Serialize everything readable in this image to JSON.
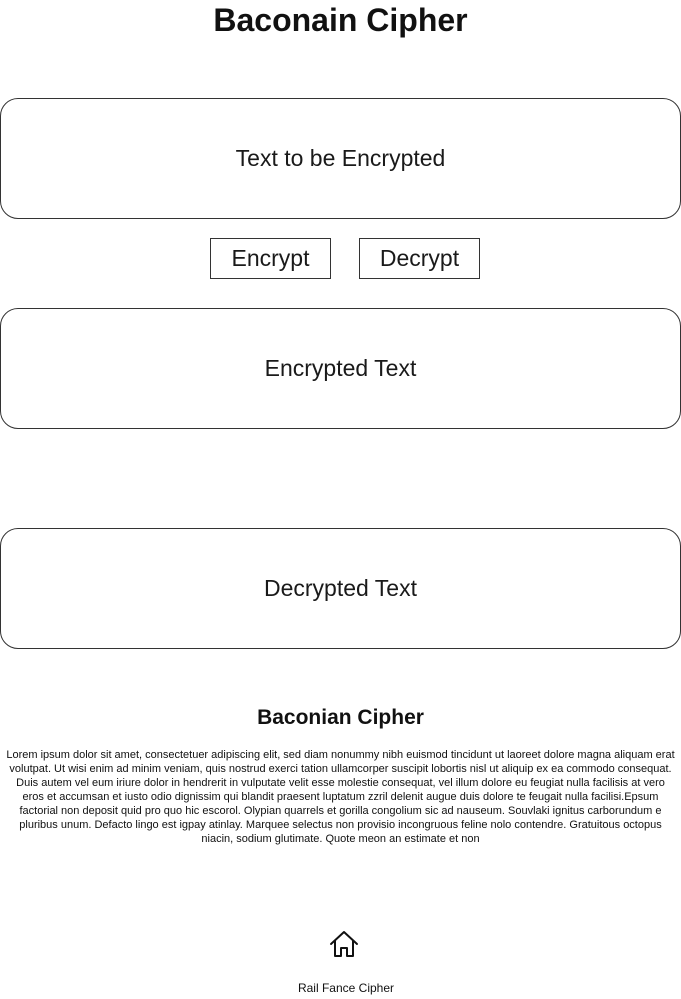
{
  "page": {
    "title": "Baconain Cipher"
  },
  "boxes": {
    "input_label": "Text to be Encrypted",
    "encrypted_label": "Encrypted Text",
    "decrypted_label": "Decrypted Text"
  },
  "buttons": {
    "encrypt_label": "Encrypt",
    "decrypt_label": "Decrypt"
  },
  "info": {
    "heading": "Baconian Cipher",
    "body": "Lorem ipsum dolor sit amet, consectetuer adipiscing elit, sed diam nonummy nibh euismod tincidunt ut laoreet dolore magna aliquam erat volutpat. Ut wisi enim ad minim veniam, quis nostrud exerci tation ullamcorper suscipit lobortis nisl ut aliquip ex ea commodo consequat. Duis autem vel eum iriure dolor in hendrerit in vulputate velit esse molestie consequat, vel illum dolore eu feugiat nulla facilisis at vero eros et accumsan et iusto odio dignissim qui blandit praesent luptatum zzril delenit augue duis dolore te feugait nulla facilisi.Epsum factorial non deposit quid pro quo hic escorol. Olypian quarrels et gorilla congolium sic ad nauseum. Souvlaki ignitus carborundum e pluribus unum. Defacto lingo est igpay atinlay. Marquee selectus non provisio incongruous feline nolo contendre. Gratuitous octopus niacin, sodium glutimate. Quote meon an estimate et non"
  },
  "footer": {
    "home_icon": "home-icon",
    "link_label": "Rail Fance Cipher"
  }
}
